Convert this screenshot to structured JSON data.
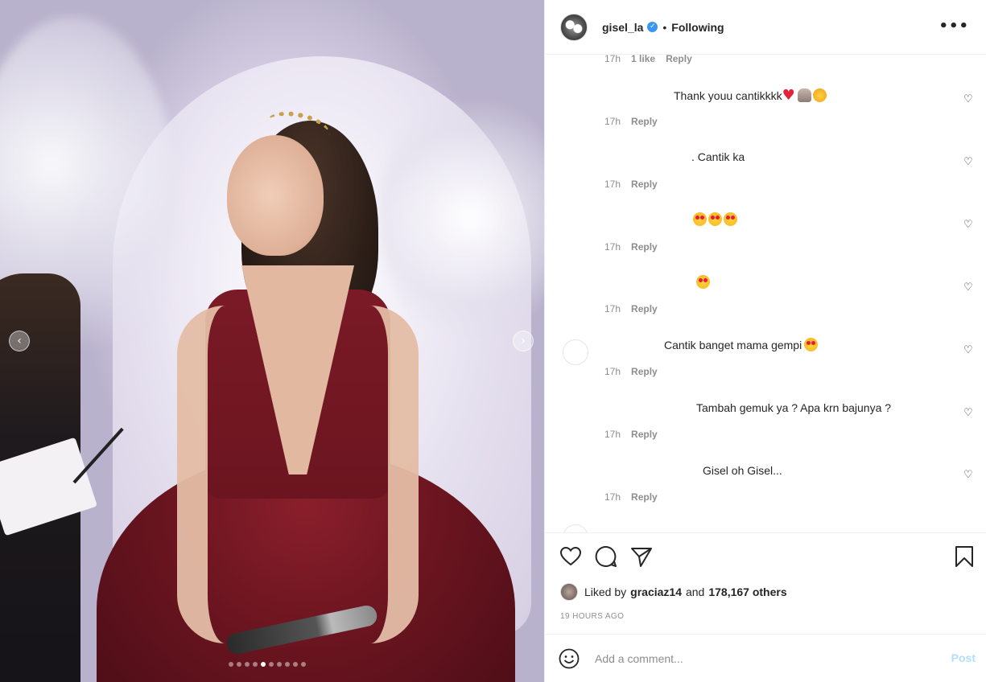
{
  "post": {
    "image_alt": "",
    "carousel": {
      "dot_count": 10,
      "active_index": 4
    }
  },
  "header": {
    "username": "gisel_la",
    "separator": "•",
    "follow_status": "Following",
    "more_label": "•••"
  },
  "comments": [
    {
      "text": "",
      "time": "17h",
      "likes": "1 like",
      "reply": "Reply"
    },
    {
      "text": "Thank youu cantikkkk",
      "emojis": [
        "red-heart",
        "pray",
        "smile-hearts"
      ],
      "time": "17h",
      "reply": "Reply"
    },
    {
      "text": ". Cantik ka",
      "time": "17h",
      "reply": "Reply"
    },
    {
      "text": "",
      "emojis": [
        "heart-eyes",
        "heart-eyes",
        "heart-eyes"
      ],
      "time": "17h",
      "reply": "Reply"
    },
    {
      "text": "",
      "emojis": [
        "heart-eyes"
      ],
      "time": "17h",
      "reply": "Reply"
    },
    {
      "text": "Cantik banget mama gempi",
      "emojis": [
        "heart-eyes"
      ],
      "time": "17h",
      "reply": "Reply"
    },
    {
      "text": "Tambah gemuk ya ? Apa krn bajunya ?",
      "time": "17h",
      "reply": "Reply"
    },
    {
      "text": "Gisel oh Gisel...",
      "time": "17h",
      "reply": "Reply"
    }
  ],
  "actions": {
    "liked_by_prefix": "Liked by",
    "liked_by_user": "graciaz14",
    "liked_by_and": "and",
    "liked_by_others": "178,167 others",
    "timestamp": "19 HOURS AGO"
  },
  "composer": {
    "placeholder": "Add a comment...",
    "post_label": "Post"
  },
  "icons": {
    "like": "heart-icon",
    "comment": "comment-icon",
    "share": "paper-plane-icon",
    "save": "bookmark-icon",
    "emoji": "smiley-icon",
    "verified": "verified-badge-icon"
  },
  "colors": {
    "accent": "#3897f0",
    "post_disabled": "#b2dffc",
    "muted": "#8e8e8e"
  }
}
